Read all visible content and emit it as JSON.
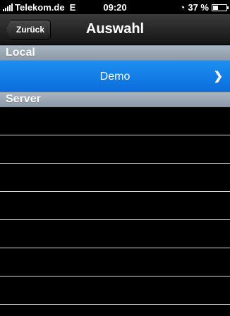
{
  "status_bar": {
    "carrier": "Telekom.de",
    "network": "E",
    "time": "09:20",
    "battery": "37 %",
    "battery_level": 0.37
  },
  "nav": {
    "back_label": "Zurück",
    "title": "Auswahl"
  },
  "sections": [
    {
      "header": "Local",
      "items": [
        {
          "label": "Demo",
          "selected": true
        }
      ]
    },
    {
      "header": "Server",
      "items": []
    }
  ],
  "colors": {
    "selection": "#0b6ddc",
    "section_header": "#9aa6b3"
  }
}
